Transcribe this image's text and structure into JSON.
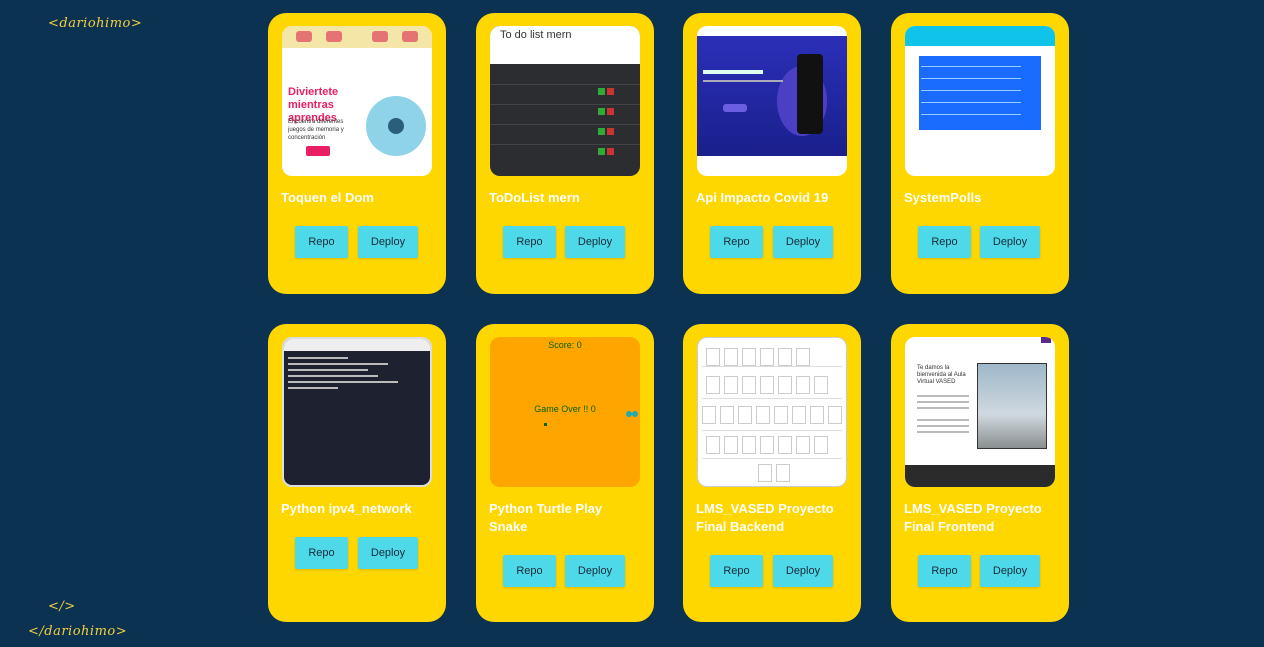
{
  "brand": {
    "open_tag": "<dariohimo>",
    "close_tag": "</>",
    "close_brand": "</dariohimo>"
  },
  "projects": [
    {
      "title": "Toquen el Dom",
      "repo_label": "Repo",
      "deploy_label": "Deploy",
      "thumb_heading": "Diviertete mientras aprendes",
      "thumb_text": "Encuentra diferentes juegos de memoria y concentración"
    },
    {
      "title": "ToDoList mern",
      "repo_label": "Repo",
      "deploy_label": "Deploy",
      "thumb_heading": "To do list mern"
    },
    {
      "title": "Api Impacto Covid 19",
      "repo_label": "Repo",
      "deploy_label": "Deploy",
      "thumb_heading": "Download the covid app for get latest update"
    },
    {
      "title": "SystemPolls",
      "repo_label": "Repo",
      "deploy_label": "Deploy",
      "thumb_heading": "Django Polls Application"
    },
    {
      "title": "Python ipv4_network",
      "repo_label": "Repo",
      "deploy_label": "Deploy"
    },
    {
      "title": "Python Turtle Play Snake",
      "repo_label": "Repo",
      "deploy_label": "Deploy",
      "thumb_score": "Score: 0",
      "thumb_gameover": "Game Over !! 0"
    },
    {
      "title": "LMS_VASED Proyecto Final Backend",
      "repo_label": "Repo",
      "deploy_label": "Deploy"
    },
    {
      "title": "LMS_VASED Proyecto Final Frontend",
      "repo_label": "Repo",
      "deploy_label": "Deploy",
      "thumb_heading": "Te damos la bienvenida al Aula Virtual VASED"
    }
  ],
  "colors": {
    "background": "#0b3250",
    "card": "#ffd700",
    "button": "#4dd9e8",
    "tag": "#f4d03f"
  }
}
